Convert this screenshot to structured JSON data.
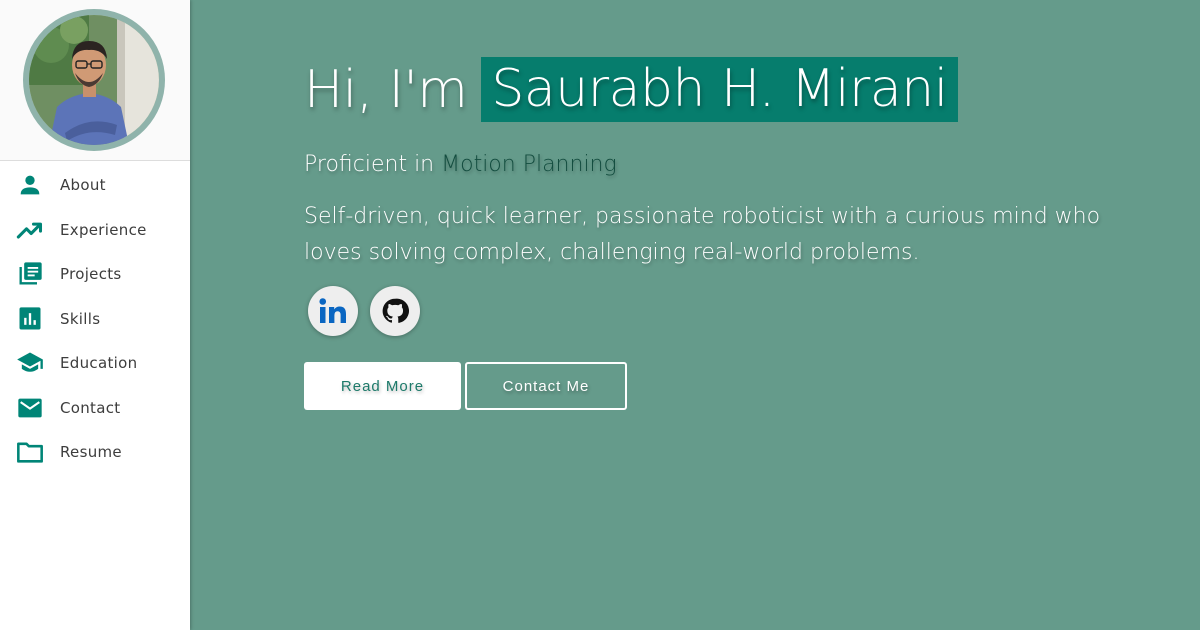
{
  "theme": {
    "accent": "#008577",
    "background": "#659b8b",
    "name_highlight": "#067d6d",
    "sidebar_bg": "#ffffff"
  },
  "sidebar": {
    "profile_photo": "profile-photo",
    "items": [
      {
        "label": "About",
        "icon": "person-icon"
      },
      {
        "label": "Experience",
        "icon": "trending-up-icon"
      },
      {
        "label": "Projects",
        "icon": "library-books-icon"
      },
      {
        "label": "Skills",
        "icon": "bar-chart-icon"
      },
      {
        "label": "Education",
        "icon": "graduation-cap-icon"
      },
      {
        "label": "Contact",
        "icon": "email-icon"
      },
      {
        "label": "Resume",
        "icon": "folder-icon"
      }
    ]
  },
  "hero": {
    "greeting": "Hi, I'm",
    "name": "Saurabh H. Mirani",
    "proficient_prefix": "Proficient in",
    "proficient_skill": "Motion Planning",
    "tagline": "Self-driven, quick learner, passionate roboticist with a curious mind who loves solving complex, challenging real-world problems."
  },
  "social": [
    {
      "name": "LinkedIn",
      "icon": "linkedin-icon"
    },
    {
      "name": "GitHub",
      "icon": "github-icon"
    }
  ],
  "buttons": {
    "read_more": "Read More",
    "contact_me": "Contact Me"
  }
}
